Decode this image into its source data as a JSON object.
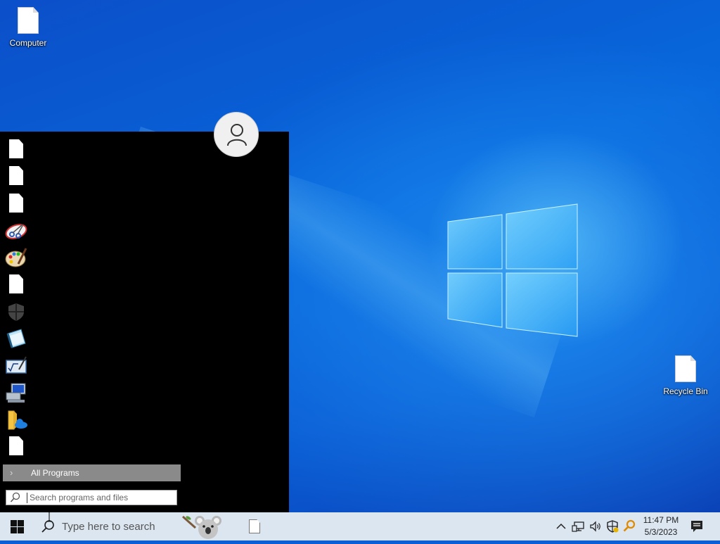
{
  "desktop": {
    "icons": [
      {
        "label": "Computer"
      },
      {
        "label": "Recycle Bin"
      }
    ]
  },
  "start_menu": {
    "all_programs_label": "All Programs",
    "search_placeholder": "Search programs and files",
    "apps": [
      {
        "icon": "blank-file-icon"
      },
      {
        "icon": "blank-file-icon"
      },
      {
        "icon": "blank-file-icon"
      },
      {
        "icon": "snipping-tool-icon"
      },
      {
        "icon": "paint-icon"
      },
      {
        "icon": "blank-file-icon"
      },
      {
        "icon": "windows-security-shield-icon"
      },
      {
        "icon": "notepad-icon"
      },
      {
        "icon": "math-input-panel-icon"
      },
      {
        "icon": "remote-desktop-icon"
      },
      {
        "icon": "onedrive-folder-icon"
      },
      {
        "icon": "blank-file-icon"
      }
    ]
  },
  "taskbar": {
    "search_placeholder": "Type here to search",
    "clock_time": "11:47 PM",
    "clock_date": "5/3/2023",
    "tray_icons": [
      "chevron-up-icon",
      "network-icon",
      "volume-icon",
      "security-shield-icon",
      "search-key-icon"
    ]
  },
  "colors": {
    "desktop_blue": "#0a5fd6",
    "start_menu_bg": "#000000",
    "all_programs_bg": "#8a8a8a",
    "taskbar_bg": "#dce6f1"
  }
}
